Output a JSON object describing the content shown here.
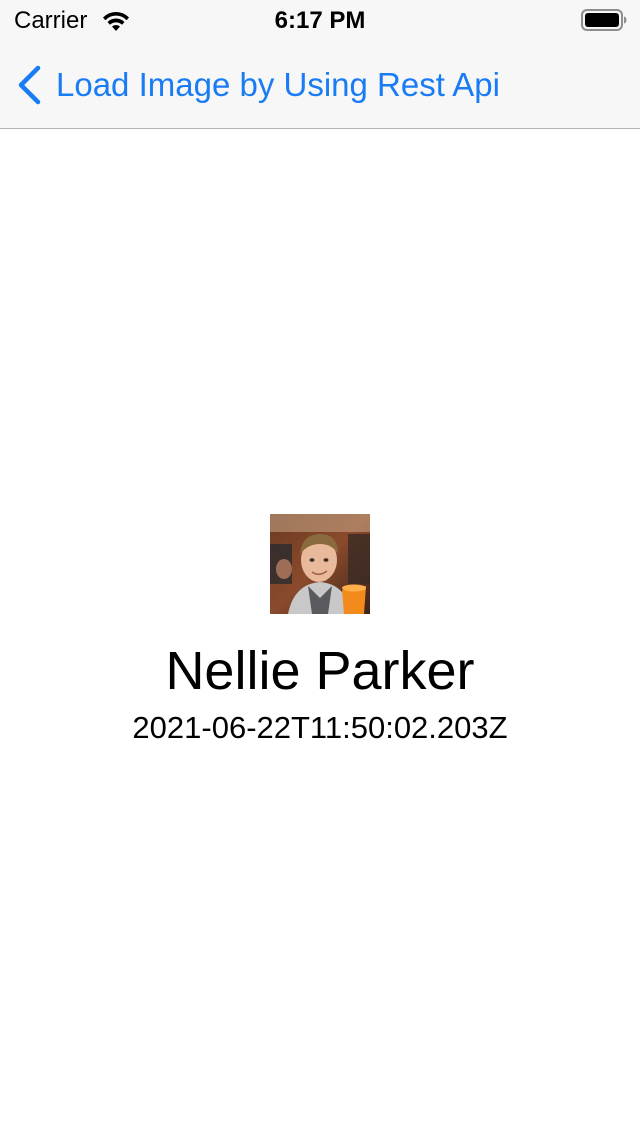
{
  "status_bar": {
    "carrier": "Carrier",
    "time": "6:17 PM"
  },
  "nav": {
    "back_label": "Load Image by Using Rest Api",
    "accent_color": "#1a7cf5"
  },
  "profile": {
    "name": "Nellie Parker",
    "timestamp": "2021-06-22T11:50:02.203Z",
    "avatar_icon": "profile-photo"
  }
}
